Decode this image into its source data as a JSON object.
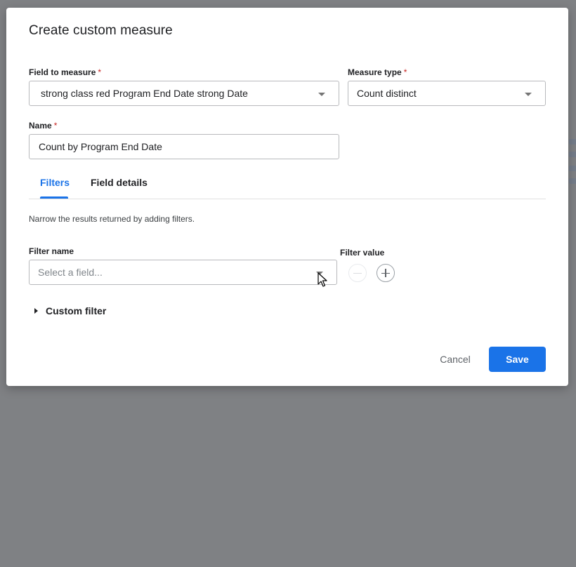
{
  "dialog": {
    "title": "Create custom measure"
  },
  "field_to_measure": {
    "label": "Field to measure",
    "required_mark": "*",
    "value": "strong class red Program End Date strong  Date"
  },
  "measure_type": {
    "label": "Measure type",
    "required_mark": "*",
    "value": "Count distinct"
  },
  "name": {
    "label": "Name",
    "required_mark": "*",
    "value": "Count by Program End Date"
  },
  "tabs": [
    {
      "label": "Filters",
      "active": true
    },
    {
      "label": "Field details",
      "active": false
    }
  ],
  "filters": {
    "helper_text": "Narrow the results returned by adding filters.",
    "filter_name_label": "Filter name",
    "filter_name_placeholder": "Select a field...",
    "filter_value_label": "Filter value",
    "remove_icon": "minus-circle-icon",
    "add_icon": "plus-circle-icon"
  },
  "custom_filter": {
    "label": "Custom filter",
    "icon": "caret-right-icon"
  },
  "footer": {
    "cancel_label": "Cancel",
    "save_label": "Save"
  },
  "colors": {
    "accent": "#1a73e8",
    "required": "#c5221f",
    "backdrop": "#7f8184"
  }
}
